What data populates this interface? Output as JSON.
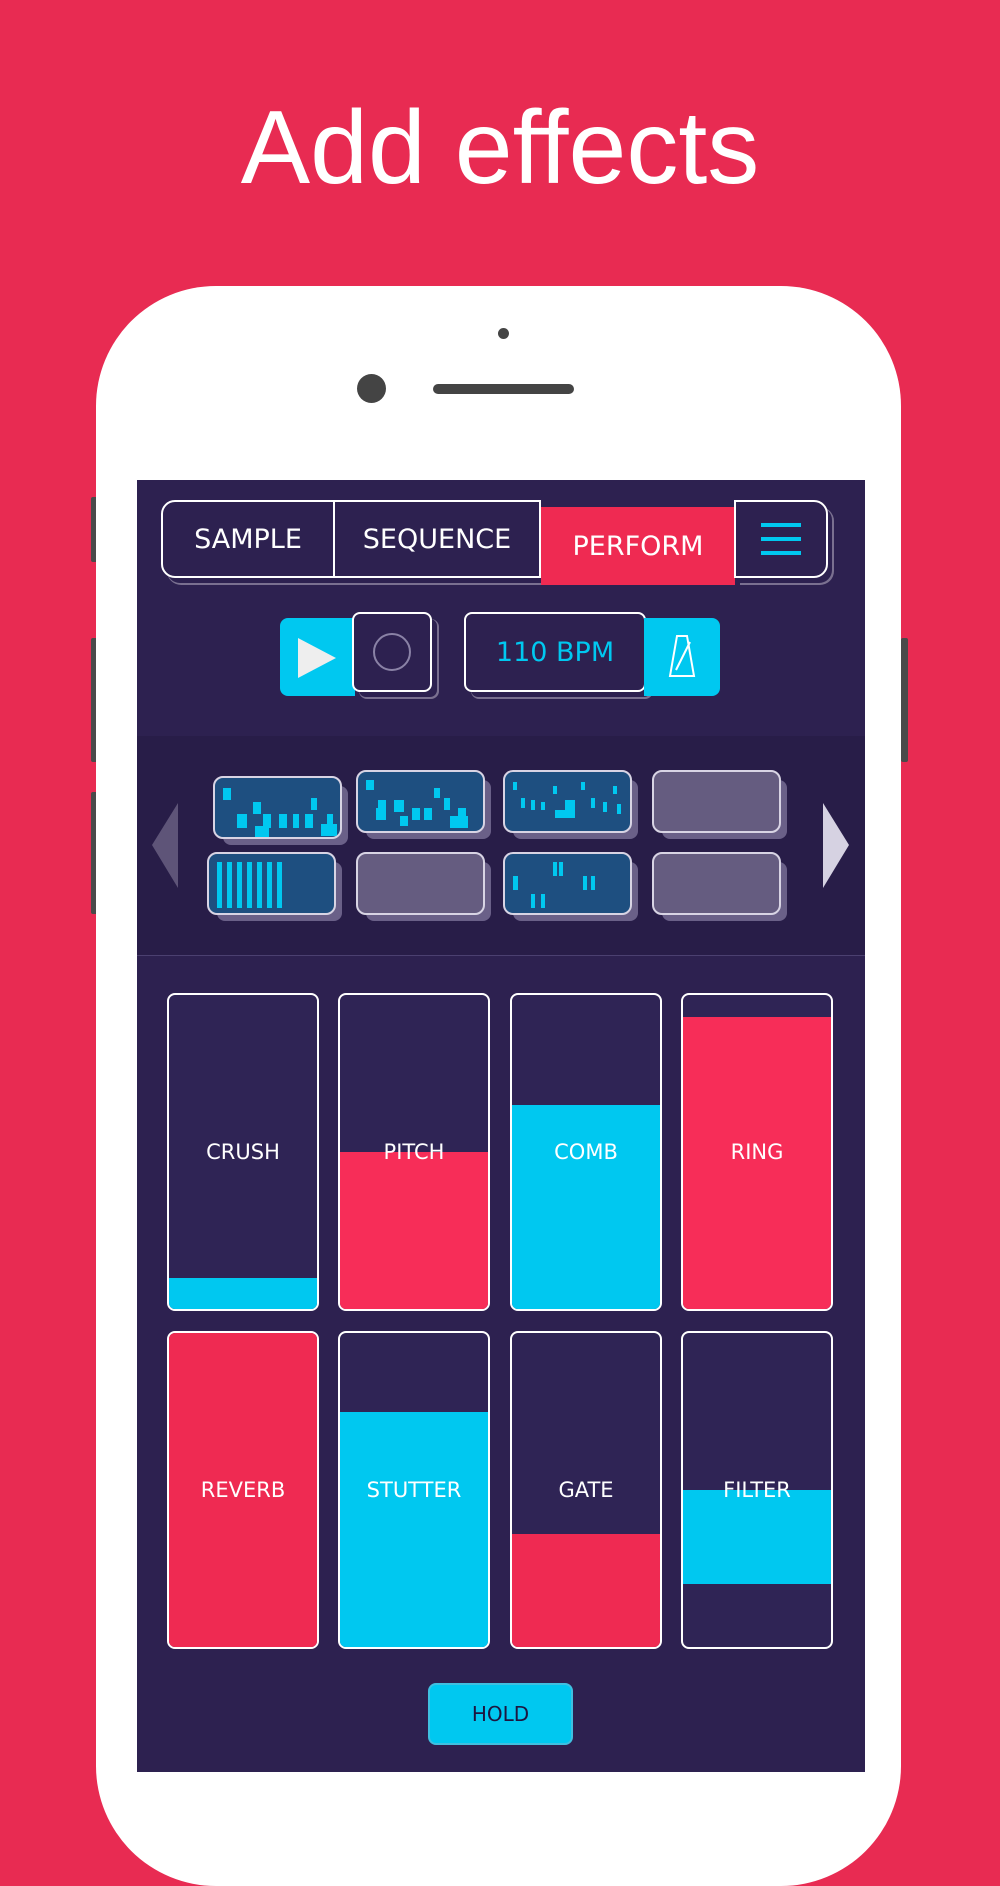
{
  "headline": "Add effects",
  "tabs": [
    {
      "label": "SAMPLE",
      "active": false
    },
    {
      "label": "SEQUENCE",
      "active": false
    },
    {
      "label": "PERFORM",
      "active": true
    }
  ],
  "menu_icon": "hamburger-menu-icon",
  "transport": {
    "play_icon": "play-icon",
    "record_icon": "record-icon",
    "bpm": "110 BPM",
    "metronome_icon": "metronome-icon"
  },
  "patterns": [
    {
      "filled": true
    },
    {
      "filled": true
    },
    {
      "filled": true
    },
    {
      "filled": false
    },
    {
      "filled": true
    },
    {
      "filled": false
    },
    {
      "filled": true
    },
    {
      "filled": false
    }
  ],
  "pads": [
    {
      "label": "CRUSH",
      "color": "#00c8f0",
      "level": [
        0,
        0.1
      ]
    },
    {
      "label": "PITCH",
      "color": "#f72d58",
      "level": [
        0,
        0.5
      ]
    },
    {
      "label": "COMB",
      "color": "#00c8f0",
      "level": [
        0,
        0.65
      ]
    },
    {
      "label": "RING",
      "color": "#f72d58",
      "level": [
        0,
        0.93
      ]
    },
    {
      "label": "REVERB",
      "color": "#ef2a52",
      "level": [
        0,
        1.0
      ]
    },
    {
      "label": "STUTTER",
      "color": "#00c8f0",
      "level": [
        0,
        0.75
      ]
    },
    {
      "label": "GATE",
      "color": "#ef2a52",
      "level": [
        0,
        0.36
      ]
    },
    {
      "label": "FILTER",
      "color": "#00c8f0",
      "level": [
        0.2,
        0.5
      ]
    }
  ],
  "hold_label": "HOLD",
  "colors": {
    "background": "#e82b52",
    "screen": "#2d2150",
    "accent_cyan": "#00c8f0",
    "accent_red": "#ef2a52"
  }
}
